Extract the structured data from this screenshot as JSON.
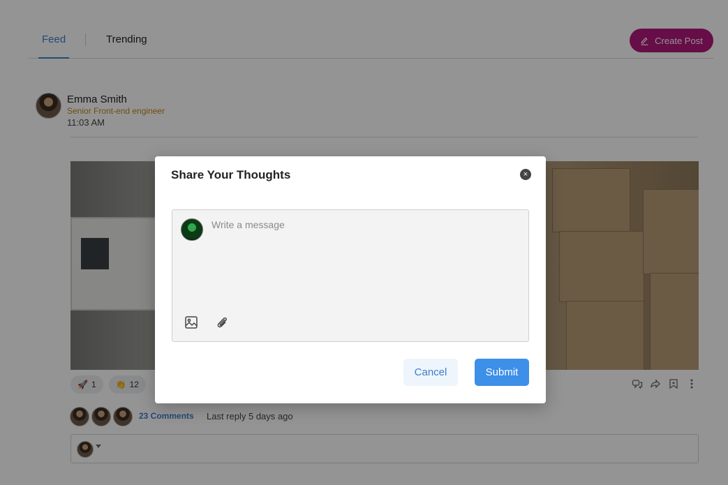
{
  "tabs": {
    "feed": "Feed",
    "trending": "Trending"
  },
  "create_post": {
    "label": "Create Post"
  },
  "post": {
    "author": "Emma Smith",
    "role": "Senior Front-end engineer",
    "time": "11:03 AM",
    "reactions": [
      {
        "icon": "🚀",
        "count": "1"
      },
      {
        "icon": "👏",
        "count": "12"
      }
    ],
    "comments_count": "23 Comments",
    "last_reply": "Last reply 5 days ago"
  },
  "modal": {
    "title": "Share Your Thoughts",
    "close_icon": "×",
    "placeholder": "Write a message",
    "cancel": "Cancel",
    "submit": "Submit"
  },
  "colors": {
    "accent": "#3d7fcc",
    "create_post": "#b2187c",
    "role": "#c5841d",
    "submit": "#3d8fe8"
  }
}
